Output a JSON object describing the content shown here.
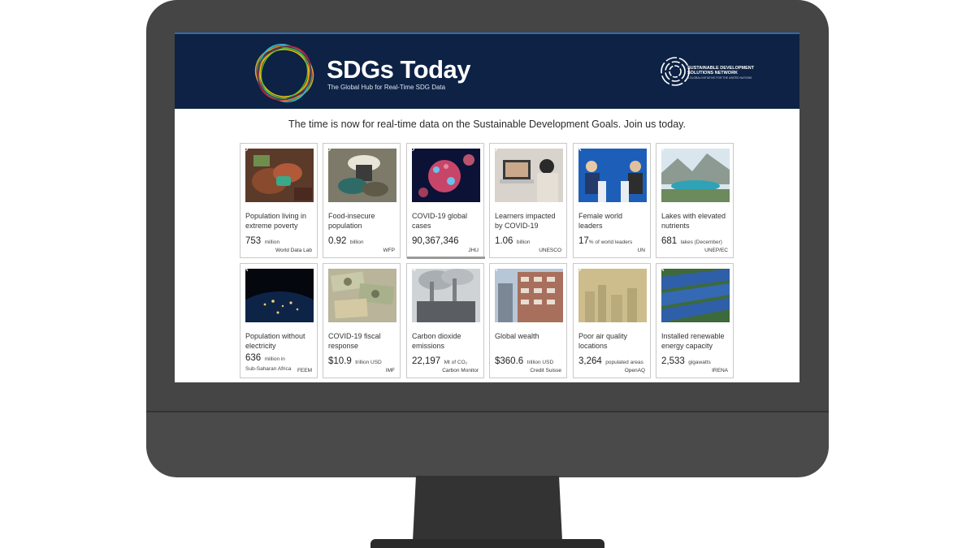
{
  "header": {
    "title": "SDGs Today",
    "tagline": "The Global Hub for Real-Time SDG Data",
    "partner_name_line1": "SUSTAINABLE DEVELOPMENT",
    "partner_name_line2": "SOLUTIONS NETWORK",
    "partner_sub": "A GLOBAL INITIATIVE FOR THE UNITED NATIONS"
  },
  "intro_text": "The time is now for real-time data on the Sustainable Development Goals. Join us today.",
  "cards": [
    {
      "badge": "D",
      "title": "Population living in extreme poverty",
      "value": "753",
      "unit": "million",
      "source": "World Data Lab",
      "image": "hands-photo"
    },
    {
      "badge": "D",
      "title": "Food-insecure population",
      "value": "0.92",
      "unit": "billion",
      "source": "WFP",
      "image": "farmer-photo"
    },
    {
      "badge": "D",
      "title": "COVID-19 global cases",
      "value": "90,367,346",
      "unit": "",
      "source": "JHU",
      "image": "virus-photo"
    },
    {
      "badge": "D",
      "title": "Learners impacted by COVID-19",
      "value": "1.06",
      "unit": "billion",
      "source": "UNESCO",
      "image": "laptop-learner-photo"
    },
    {
      "badge": "A",
      "title": "Female world leaders",
      "value": "17",
      "unit": "% of world leaders",
      "source": "UN",
      "image": "leaders-photo"
    },
    {
      "badge": "A",
      "title": "Lakes with elevated nutrients",
      "value": "681",
      "unit": "lakes (December)",
      "source": "UNEP/EC",
      "image": "lake-photo"
    },
    {
      "badge": "A",
      "title": "Population without electricity",
      "value": "636",
      "unit": "million in Sub-Saharan Africa",
      "source": "FEEM",
      "image": "night-earth-photo"
    },
    {
      "badge": "",
      "title": "COVID-19 fiscal response",
      "value": "$10.9",
      "unit": "trillion USD",
      "source": "IMF",
      "image": "banknotes-photo"
    },
    {
      "badge": "W",
      "title": "Carbon dioxide emissions",
      "value": "22,197",
      "unit": "Mt of CO₂",
      "source": "Carbon Monitor",
      "image": "power-plant-photo"
    },
    {
      "badge": "A",
      "title": "Global wealth",
      "value": "$360.6",
      "unit": "trillion USD",
      "source": "Credit Suisse",
      "image": "apartments-photo"
    },
    {
      "badge": "D",
      "title": "Poor air quality locations",
      "value": "3,264",
      "unit": "populated areas",
      "source": "OpenAQ",
      "image": "smog-city-photo"
    },
    {
      "badge": "A",
      "title": "Installed renewable energy capacity",
      "value": "2,533",
      "unit": "gigawatts",
      "source": "IRENA",
      "image": "solar-panels-photo"
    }
  ],
  "colors": {
    "banner": "#0d2244",
    "bezel": "#454545",
    "card_border": "#c9c9c9"
  }
}
